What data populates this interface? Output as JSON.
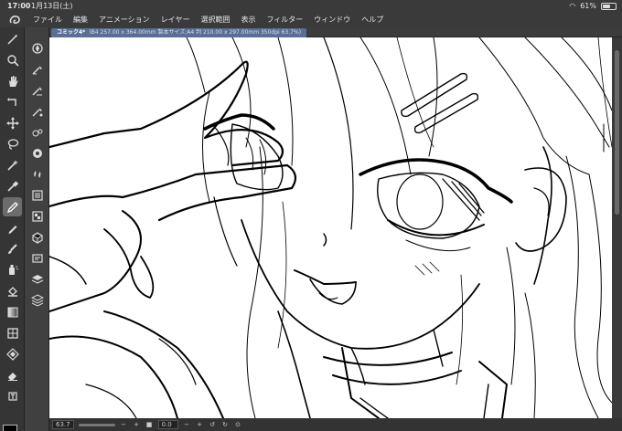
{
  "status_bar": {
    "time": "17:00",
    "date": "1月13日(土)",
    "battery": "61%",
    "battery_level": 0.61
  },
  "menu": {
    "items": [
      "ファイル",
      "編集",
      "アニメーション",
      "レイヤー",
      "選択範囲",
      "表示",
      "フィルター",
      "ウィンドウ",
      "ヘルプ"
    ]
  },
  "document_tab": {
    "title": "コミック4*",
    "info": "(B4 257.00 x 364.00mm 製本サイズ:A4 判 210.00 x 297.00mm 350dpi 63.7%)"
  },
  "bottom_bar": {
    "zoom": "63.7",
    "minus": "−",
    "plus": "+",
    "rotation": "0.0",
    "angle_minus": "−",
    "angle_plus": "+"
  },
  "colors": {
    "foreground": "#000000",
    "background": "#ffffff",
    "active_tool_bg": "#6c6c6c",
    "tab_bg": "#5a6f94"
  },
  "tools": [
    "pen-stroke-icon",
    "zoom-icon",
    "hand-icon",
    "rotate-icon",
    "move-icon",
    "lasso-icon",
    "magic-wand-icon",
    "eyedropper-icon",
    "pen-icon",
    "pencil-icon",
    "brush-icon",
    "airbrush-icon",
    "eraser-icon",
    "fill-icon",
    "gradient-icon",
    "frame-icon",
    "ruler-icon",
    "text-icon",
    "balloon-icon"
  ],
  "subtools": [
    "navigator-icon",
    "layer-property-icon",
    "sub-tool-icon",
    "tool-property-icon",
    "brush-size-icon",
    "color-wheel-icon",
    "color-set-icon",
    "intermediate-color-icon",
    "color-history-icon",
    "material-icon",
    "layer-search-icon",
    "layer-icon",
    "stack-icon"
  ]
}
